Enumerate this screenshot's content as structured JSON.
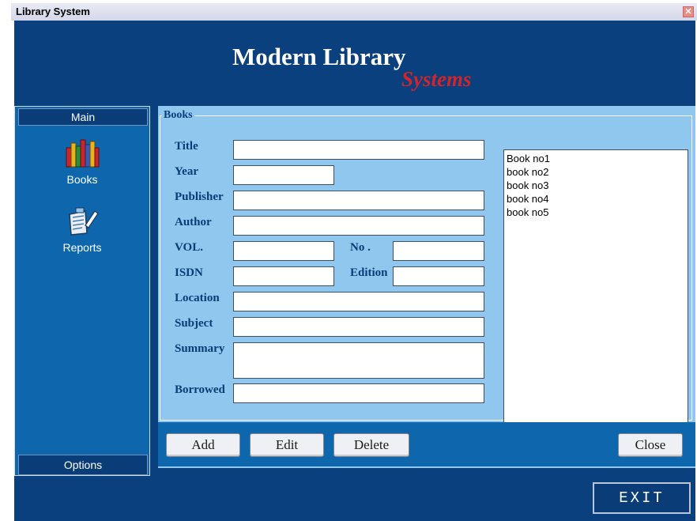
{
  "window": {
    "title": "Library System",
    "close_glyph": "✕"
  },
  "banner": {
    "brand": "Modern Library",
    "brand_sub": "Systems"
  },
  "sidebar": {
    "section": "Main",
    "items": [
      {
        "label": "Books",
        "icon": "books-icon"
      },
      {
        "label": "Reports",
        "icon": "reports-icon"
      }
    ],
    "footer": "Options"
  },
  "form": {
    "legend": "Books",
    "labels": {
      "title": "Title",
      "year": "Year",
      "publisher": "Publisher",
      "author": "Author",
      "vol": "VOL.",
      "no": "No .",
      "isdn": "ISDN",
      "edition": "Edition",
      "location": "Location",
      "subject": "Subject",
      "summary": "Summary",
      "borrowed": "Borrowed"
    },
    "values": {
      "title": "",
      "year": "",
      "publisher": "",
      "author": "",
      "vol": "",
      "no": "",
      "isdn": "",
      "edition": "",
      "location": "",
      "subject": "",
      "summary": "",
      "borrowed": ""
    }
  },
  "book_list": [
    "Book no1",
    "book no2",
    "book no3",
    "book no4",
    "book no5"
  ],
  "buttons": {
    "add": "Add",
    "edit": "Edit",
    "delete": "Delete",
    "close": "Close"
  },
  "exit": "EXIT",
  "colors": {
    "app_bg": "#0a407d",
    "panel_bg": "#0e67ac",
    "form_bg": "#8fc7ee",
    "brand_sub": "#d3232b"
  }
}
